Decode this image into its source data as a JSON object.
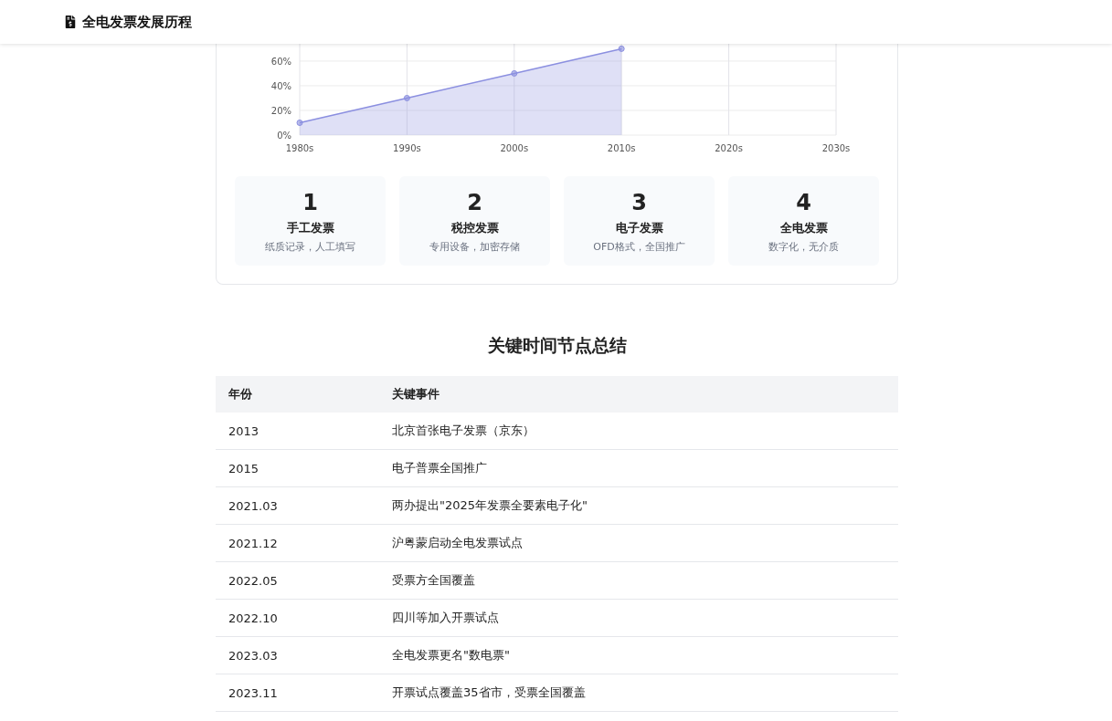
{
  "header": {
    "title": "全电发票发展历程"
  },
  "chart": {
    "chart_data": {
      "type": "area",
      "categories": [
        "1980s",
        "1990s",
        "2000s",
        "2010s",
        "2020s",
        "2030s"
      ],
      "series": [
        {
          "color": "#8b8fe0",
          "values": [
            10,
            30,
            50,
            70,
            null,
            null
          ]
        }
      ],
      "grid": true,
      "ylim": [
        0,
        74
      ],
      "yticks": [
        {
          "value": 0,
          "label": "0%"
        },
        {
          "value": 20,
          "label": "20%"
        },
        {
          "value": 40,
          "label": "40%"
        },
        {
          "value": 60,
          "label": "60%"
        }
      ]
    }
  },
  "stages": [
    {
      "number": "1",
      "title": "手工发票",
      "desc": "纸质记录，人工填写"
    },
    {
      "number": "2",
      "title": "税控发票",
      "desc": "专用设备，加密存储"
    },
    {
      "number": "3",
      "title": "电子发票",
      "desc": "OFD格式，全国推广"
    },
    {
      "number": "4",
      "title": "全电发票",
      "desc": "数字化，无介质"
    }
  ],
  "summary": {
    "title": "关键时间节点总结",
    "columns": [
      "年份",
      "关键事件"
    ],
    "rows": [
      [
        "2013",
        "北京首张电子发票（京东）"
      ],
      [
        "2015",
        "电子普票全国推广"
      ],
      [
        "2021.03",
        "两办提出\"2025年发票全要素电子化\""
      ],
      [
        "2021.12",
        "沪粤蒙启动全电发票试点"
      ],
      [
        "2022.05",
        "受票方全国覆盖"
      ],
      [
        "2022.10",
        "四川等加入开票试点"
      ],
      [
        "2023.03",
        "全电发票更名\"数电票\""
      ],
      [
        "2023.11",
        "开票试点覆盖35省市，受票全国覆盖"
      ]
    ]
  }
}
